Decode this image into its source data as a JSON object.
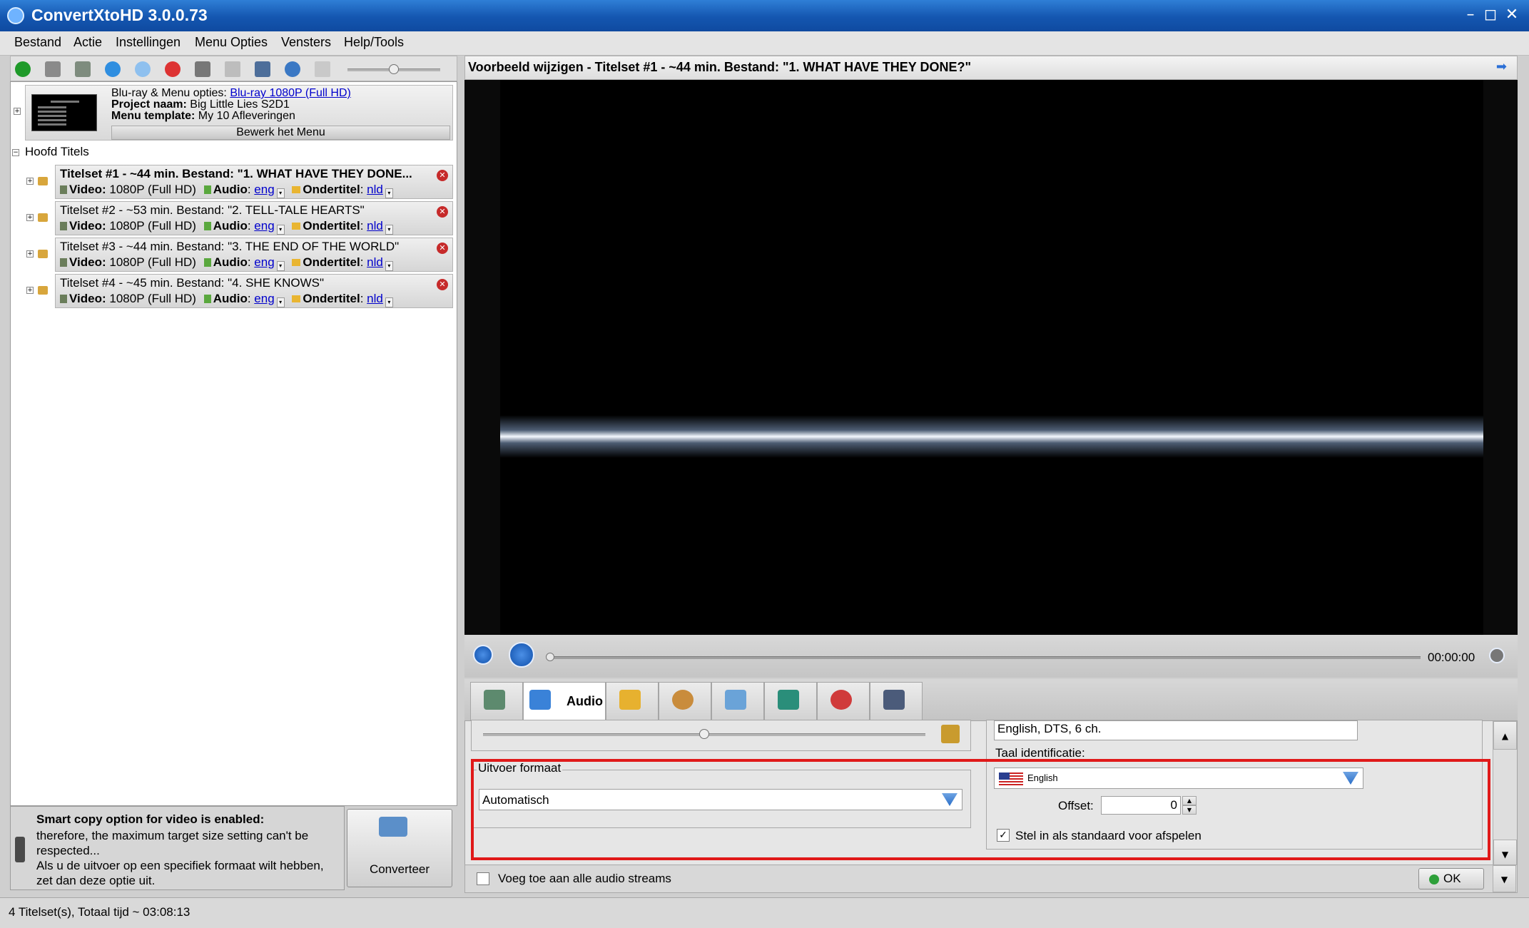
{
  "window": {
    "title": "ConvertXtoHD 3.0.0.73",
    "controls": {
      "minimize": "–",
      "restore": "◻",
      "close": "✕"
    }
  },
  "menu": {
    "items": [
      {
        "label": "Bestand"
      },
      {
        "label": "Actie"
      },
      {
        "label": "Instellingen"
      },
      {
        "label": "Menu Opties"
      },
      {
        "label": "Vensters"
      },
      {
        "label": "Help/Tools"
      }
    ]
  },
  "toolbar": {
    "icons": [
      "add-icon",
      "save-icon",
      "settings-icon",
      "download-icon",
      "info-icon",
      "delete-icon",
      "tools-icon",
      "page-icon",
      "monitor-icon",
      "disc-icon",
      "document-icon"
    ]
  },
  "project": {
    "bluray_label": "Blu-ray & Menu opties:",
    "bluray_value": "Blu-ray 1080P (Full HD)",
    "project_label": "Project naam:",
    "project_value": "Big Little Lies S2D1",
    "template_label": "Menu template:",
    "template_value": "My  10 Afleveringen",
    "edit_menu": "Bewerk het Menu"
  },
  "tree": {
    "root_label": "Hoofd Titels",
    "video_label": "Video:",
    "audio_label": "Audio",
    "subtitle_label": "Ondertitel",
    "titlesets": [
      {
        "title": "Titelset #1 - ~44 min. Bestand: \"1. WHAT HAVE THEY DONE...",
        "video": "1080P (Full HD)",
        "audio": "eng",
        "subtitle": "nld",
        "bold": true
      },
      {
        "title": "Titelset #2 - ~53 min. Bestand: \"2. TELL-TALE HEARTS\"",
        "video": "1080P (Full HD)",
        "audio": "eng",
        "subtitle": "nld",
        "bold": false
      },
      {
        "title": "Titelset #3 - ~44 min. Bestand: \"3. THE END OF THE WORLD\"",
        "video": "1080P (Full HD)",
        "audio": "eng",
        "subtitle": "nld",
        "bold": false
      },
      {
        "title": "Titelset #4 - ~45 min. Bestand: \"4. SHE KNOWS\"",
        "video": "1080P (Full HD)",
        "audio": "eng",
        "subtitle": "nld",
        "bold": false
      }
    ]
  },
  "info": {
    "title": "Smart copy option for video is enabled:",
    "lines": [
      "therefore, the maximum target size setting can't be respected...",
      "Als u de uitvoer op een specifiek formaat wilt hebben, zet dan deze optie uit."
    ]
  },
  "convert_button": "Converteer",
  "preview": {
    "header": "Voorbeeld wijzigen - Titelset #1 - ~44 min. Bestand: \"1. WHAT HAVE THEY DONE?\"",
    "time": "00:00:00",
    "position_fraction": 0.0
  },
  "tabs": {
    "active_label": "Audio",
    "items": [
      "video-tab",
      "audio-tab",
      "subtitle-tab",
      "chapters-tab",
      "menu-tab",
      "resize-tab",
      "cut-tab",
      "film-tab"
    ]
  },
  "audio_panel": {
    "stream_desc": "English, DTS, 6 ch.",
    "language_label": "Taal identificatie:",
    "language_value": "English",
    "output_group": "Uitvoer formaat",
    "output_value": "Automatisch",
    "offset_label": "Offset:",
    "offset_value": "0",
    "default_label": "Stel in als standaard voor afspelen",
    "default_checked": true,
    "add_all_label": "Voeg toe aan alle audio streams",
    "add_all_checked": false,
    "ok_label": "OK",
    "volume_fraction": 0.5
  },
  "status": {
    "text": "4 Titelset(s), Totaal tijd ~ 03:08:13"
  },
  "colors": {
    "titlebar": "#1456b0",
    "highlight_box": "#e01919",
    "link": "#0000cc"
  }
}
